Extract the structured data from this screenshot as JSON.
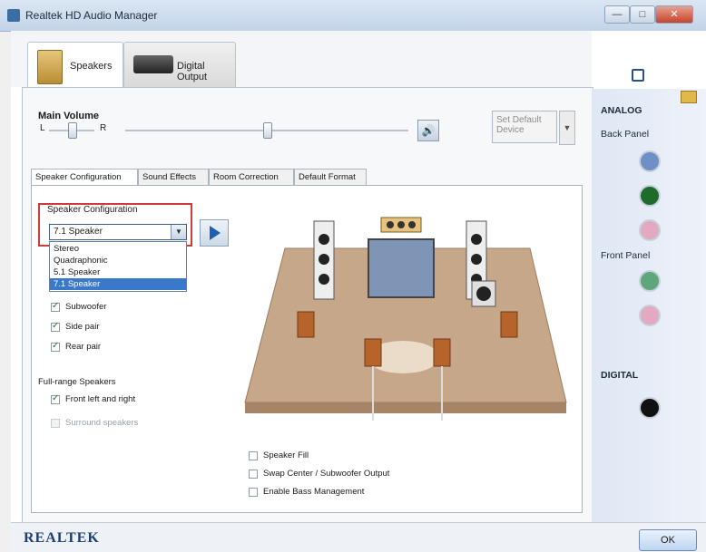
{
  "window": {
    "title": "Realtek HD Audio Manager",
    "buttons": {
      "minimize": "—",
      "maximize": "□",
      "close": "✕"
    }
  },
  "device_tabs": [
    {
      "label": "Speakers",
      "icon": "speaker-cabinet-icon",
      "active": true
    },
    {
      "label": "Digital Output",
      "icon": "optical-output-icon",
      "active": false
    }
  ],
  "volume": {
    "label": "Main Volume",
    "balance_left": "L",
    "balance_right": "R",
    "balance": 0.5,
    "level": 0.5,
    "mute_icon": "speaker-volume-icon",
    "set_default_label": "Set Default Device"
  },
  "sub_tabs": [
    {
      "label": "Speaker Configuration",
      "active": true
    },
    {
      "label": "Sound Effects",
      "active": false
    },
    {
      "label": "Room Correction",
      "active": false
    },
    {
      "label": "Default Format",
      "active": false
    }
  ],
  "speaker_config": {
    "label": "Speaker Configuration",
    "selected": "7.1 Speaker",
    "options": [
      {
        "label": "Stereo",
        "selected": false
      },
      {
        "label": "Quadraphonic",
        "selected": false
      },
      {
        "label": "5.1 Speaker",
        "selected": false
      },
      {
        "label": "7.1 Speaker",
        "selected": true
      }
    ],
    "play_icon": "play-icon"
  },
  "checkboxes": [
    {
      "label": "Subwoofer",
      "checked": true,
      "enabled": true
    },
    {
      "label": "Side pair",
      "checked": true,
      "enabled": true
    },
    {
      "label": "Rear pair",
      "checked": true,
      "enabled": true
    }
  ],
  "fullrange": {
    "label": "Full-range Speakers",
    "items": [
      {
        "label": "Front left and right",
        "checked": true,
        "enabled": true
      },
      {
        "label": "Surround speakers",
        "checked": false,
        "enabled": false
      }
    ]
  },
  "bottom_options": [
    {
      "label": "Speaker Fill",
      "checked": false
    },
    {
      "label": "Swap Center / Subwoofer Output",
      "checked": false
    },
    {
      "label": "Enable Bass Management",
      "checked": false
    }
  ],
  "right_panel": {
    "analog_label": "ANALOG",
    "back_panel_label": "Back Panel",
    "front_panel_label": "Front Panel",
    "digital_label": "DIGITAL",
    "settings_icon": "device-settings-icon",
    "folder_icon": "folder-icon",
    "back_jacks": [
      "#6f8fc7",
      "#1f6b2a",
      "#e3a9c0"
    ],
    "front_jacks": [
      "#5fa77a",
      "#e3a9c0"
    ],
    "digital_jack": "#111111"
  },
  "footer": {
    "brand": "REALTEK",
    "brand_icon": "realtek-crab-icon",
    "info_icon": "info-icon",
    "ok_label": "OK"
  }
}
